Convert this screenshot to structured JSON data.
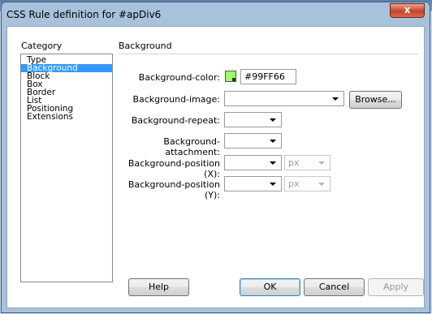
{
  "dialog": {
    "title": "CSS Rule definition for #apDiv6",
    "close_label": "x"
  },
  "category": {
    "header": "Category",
    "items": [
      {
        "label": "Type"
      },
      {
        "label": "Background",
        "selected": true
      },
      {
        "label": "Block"
      },
      {
        "label": "Box"
      },
      {
        "label": "Border"
      },
      {
        "label": "List"
      },
      {
        "label": "Positioning"
      },
      {
        "label": "Extensions"
      }
    ]
  },
  "panel": {
    "header": "Background",
    "background_color": {
      "label": "Background-color:",
      "value": "#99FF66",
      "swatch": "#99ff66"
    },
    "background_image": {
      "label": "Background-image:",
      "value": "",
      "browse_label": "Browse..."
    },
    "background_repeat": {
      "label": "Background-repeat:",
      "value": ""
    },
    "background_attachment": {
      "label": "Background-attachment:",
      "value": ""
    },
    "background_position_x": {
      "label": "Background-position (X):",
      "value": "",
      "unit": "px"
    },
    "background_position_y": {
      "label": "Background-position (Y):",
      "value": "",
      "unit": "px"
    }
  },
  "buttons": {
    "help": "Help",
    "ok": "OK",
    "cancel": "Cancel",
    "apply": "Apply"
  }
}
